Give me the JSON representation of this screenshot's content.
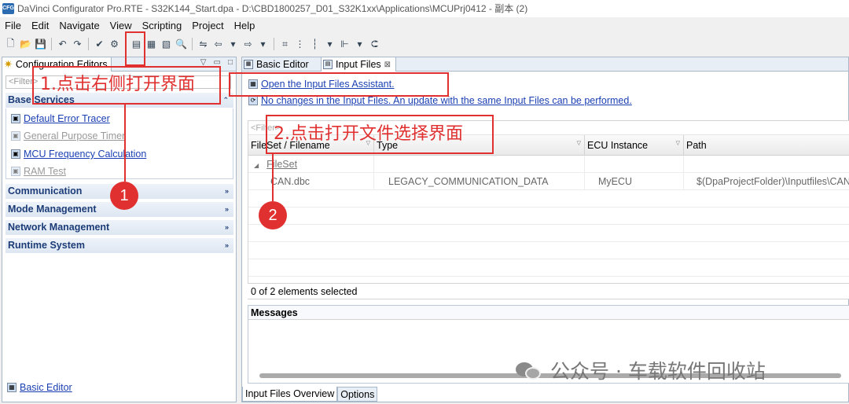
{
  "window": {
    "title": "DaVinci Configurator Pro.RTE - S32K144_Start.dpa - D:\\CBD1800257_D01_S32K1xx\\Applications\\MCUPrj0412 - 副本 (2)",
    "app_icon_text": "CFG"
  },
  "menubar": [
    "File",
    "Edit",
    "Navigate",
    "View",
    "Scripting",
    "Project",
    "Help"
  ],
  "left_panel": {
    "tab_label": "Configuration Editors",
    "filter_placeholder": "<Filter>",
    "sections": [
      {
        "title": "Base Services",
        "expanded": true
      },
      {
        "title": "Communication",
        "expanded": false
      },
      {
        "title": "Mode Management",
        "expanded": false
      },
      {
        "title": "Network Management",
        "expanded": false
      },
      {
        "title": "Runtime System",
        "expanded": false
      }
    ],
    "base_services_items": [
      {
        "label": "Default Error Tracer",
        "enabled": true
      },
      {
        "label": "General Purpose Timer",
        "enabled": false
      },
      {
        "label": "MCU Frequency Calculation",
        "enabled": true
      },
      {
        "label": "RAM Test",
        "enabled": false
      }
    ],
    "bottom_link": "Basic Editor"
  },
  "right_panel": {
    "tabs": [
      {
        "label": "Basic Editor",
        "active": false
      },
      {
        "label": "Input Files",
        "active": true,
        "close": "⊠"
      }
    ],
    "assistant_link": "Open the Input Files Assistant.",
    "update_link": "No changes in the Input Files. An update with the same Input Files can be performed.",
    "grid": {
      "filter_placeholder": "<Filter>",
      "columns": [
        "FileSet / Filename",
        "Type",
        "ECU Instance",
        "Path"
      ],
      "fileset_label": "FileSet",
      "rows": [
        {
          "name": "CAN.dbc",
          "type": "LEGACY_COMMUNICATION_DATA",
          "ecu": "MyECU",
          "path": "$(DpaProjectFolder)\\Inputfiles\\CAN"
        }
      ]
    },
    "status": "0 of 2 elements selected",
    "messages_title": "Messages",
    "bottom_tabs": [
      "Input Files Overview",
      "Options"
    ]
  },
  "annotations": {
    "step1_text": "1.点击右侧打开界面",
    "step2_text": "2.点击打开文件选择界面",
    "circle1": "1",
    "circle2": "2",
    "accent_color": "#e03030"
  },
  "watermark": {
    "text": "公众号 · 车载软件回收站"
  }
}
